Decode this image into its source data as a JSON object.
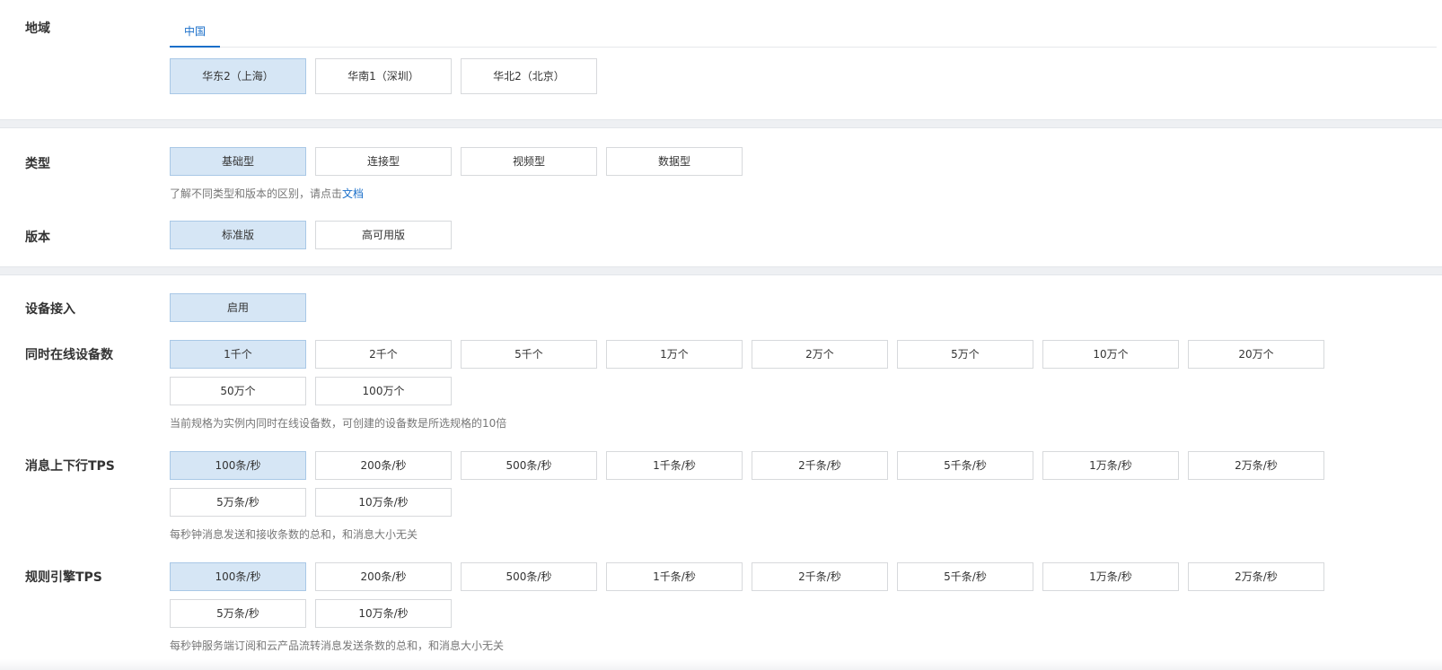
{
  "region": {
    "label": "地域",
    "tab": "中国",
    "options": [
      "华东2（上海）",
      "华南1（深圳）",
      "华北2（北京）"
    ]
  },
  "type": {
    "label": "类型",
    "options": [
      "基础型",
      "连接型",
      "视频型",
      "数据型"
    ],
    "hint_text": "了解不同类型和版本的区别，请点击",
    "hint_link": "文档"
  },
  "version": {
    "label": "版本",
    "options": [
      "标准版",
      "高可用版"
    ]
  },
  "device_access": {
    "label": "设备接入",
    "options": [
      "启用"
    ]
  },
  "online_devices": {
    "label": "同时在线设备数",
    "options": [
      "1千个",
      "2千个",
      "5千个",
      "1万个",
      "2万个",
      "5万个",
      "10万个",
      "20万个",
      "50万个",
      "100万个"
    ],
    "hint": "当前规格为实例内同时在线设备数，可创建的设备数是所选规格的10倍"
  },
  "message_tps": {
    "label": "消息上下行TPS",
    "options": [
      "100条/秒",
      "200条/秒",
      "500条/秒",
      "1千条/秒",
      "2千条/秒",
      "5千条/秒",
      "1万条/秒",
      "2万条/秒",
      "5万条/秒",
      "10万条/秒"
    ],
    "hint": "每秒钟消息发送和接收条数的总和，和消息大小无关"
  },
  "rule_tps": {
    "label": "规则引擎TPS",
    "options": [
      "100条/秒",
      "200条/秒",
      "500条/秒",
      "1千条/秒",
      "2千条/秒",
      "5千条/秒",
      "1万条/秒",
      "2万条/秒",
      "5万条/秒",
      "10万条/秒"
    ],
    "hint": "每秒钟服务端订阅和云产品流转消息发送条数的总和，和消息大小无关"
  }
}
